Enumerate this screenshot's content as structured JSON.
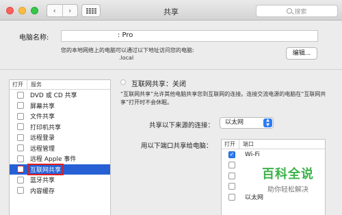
{
  "window": {
    "title": "共享"
  },
  "search": {
    "placeholder": "搜索"
  },
  "computer_name": {
    "label": "电脑名称:",
    "value_suffix": ": Pro",
    "info": "您的本地网络上的电脑可以通过以下地址访问您的电脑:",
    "local_address_suffix": ".local",
    "edit_label": "编辑..."
  },
  "services": {
    "col_on": "打开",
    "col_service": "服务",
    "items": [
      {
        "label": "DVD 或 CD 共享",
        "checked": false,
        "selected": false
      },
      {
        "label": "屏幕共享",
        "checked": false,
        "selected": false
      },
      {
        "label": "文件共享",
        "checked": false,
        "selected": false
      },
      {
        "label": "打印机共享",
        "checked": false,
        "selected": false
      },
      {
        "label": "远程登录",
        "checked": false,
        "selected": false
      },
      {
        "label": "远程管理",
        "checked": false,
        "selected": false
      },
      {
        "label": "远程 Apple 事件",
        "checked": false,
        "selected": false
      },
      {
        "label": "互联网共享",
        "checked": false,
        "selected": true
      },
      {
        "label": "蓝牙共享",
        "checked": false,
        "selected": false
      },
      {
        "label": "内容缓存",
        "checked": false,
        "selected": false
      }
    ]
  },
  "detail": {
    "status": "互联网共享：关闭",
    "description": "“互联网共享”允许其他电脑共享您到互联网的连接。连接交流电源的电脑在“互联网共享”打开时不会休眠。",
    "source_label": "共享以下来源的连接：",
    "source_value": "以太网",
    "ports_label": "用以下端口共享给电脑：",
    "ports_col_on": "打开",
    "ports_col_port": "端口",
    "ports": [
      {
        "label": "Wi-Fi",
        "checked": true
      },
      {
        "label": "",
        "checked": false
      },
      {
        "label": "",
        "checked": false
      },
      {
        "label": "",
        "checked": false
      },
      {
        "label": "以太网",
        "checked": false
      }
    ]
  },
  "watermark": {
    "title": "百科全说",
    "subtitle": "助你轻松解决"
  },
  "colors": {
    "selection": "#2660d4",
    "highlight_box": "#e21d1d",
    "accent": "#2e7cf6"
  }
}
